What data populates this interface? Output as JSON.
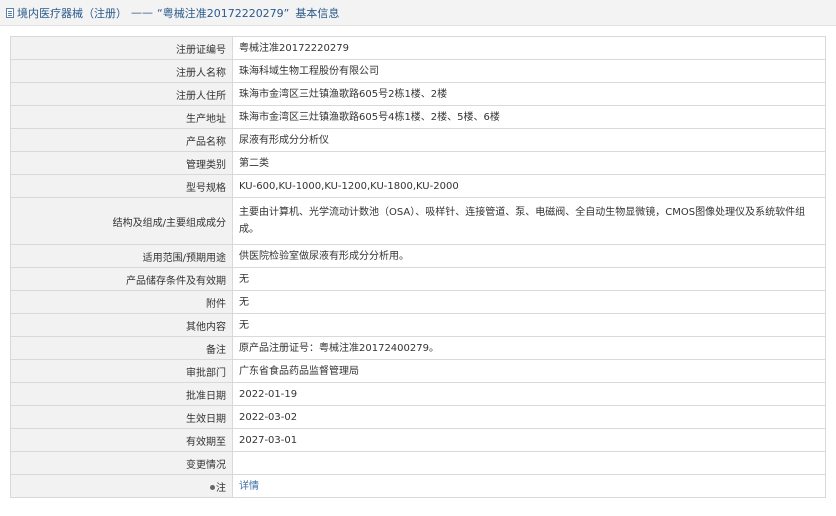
{
  "breadcrumb": {
    "category": "境内医疗器械（注册）",
    "separator": "——",
    "record": "“粤械注准20172220279”",
    "section": "基本信息"
  },
  "rows": [
    {
      "label": "注册证编号",
      "value": "粤械注准20172220279"
    },
    {
      "label": "注册人名称",
      "value": "珠海科域生物工程股份有限公司"
    },
    {
      "label": "注册人住所",
      "value": "珠海市金湾区三灶镇渔歌路605号2栋1楼、2楼"
    },
    {
      "label": "生产地址",
      "value": "珠海市金湾区三灶镇渔歌路605号4栋1楼、2楼、5楼、6楼"
    },
    {
      "label": "产品名称",
      "value": "尿液有形成分分析仪"
    },
    {
      "label": "管理类别",
      "value": "第二类"
    },
    {
      "label": "型号规格",
      "value": "KU-600,KU-1000,KU-1200,KU-1800,KU-2000"
    },
    {
      "label": "结构及组成/主要组成成分",
      "value": "主要由计算机、光学流动计数池（OSA）、吸样针、连接管道、泵、电磁阀、全自动生物显微镜，CMOS图像处理仪及系统软件组成。"
    },
    {
      "label": "适用范围/预期用途",
      "value": "供医院检验室做尿液有形成分分析用。"
    },
    {
      "label": "产品储存条件及有效期",
      "value": "无"
    },
    {
      "label": "附件",
      "value": "无"
    },
    {
      "label": "其他内容",
      "value": "无"
    },
    {
      "label": "备注",
      "value": "原产品注册证号：粤械注准20172400279。"
    },
    {
      "label": "审批部门",
      "value": "广东省食品药品监督管理局"
    },
    {
      "label": "批准日期",
      "value": "2022-01-19"
    },
    {
      "label": "生效日期",
      "value": "2022-03-02"
    },
    {
      "label": "有效期至",
      "value": "2027-03-01"
    },
    {
      "label": "变更情况",
      "value": ""
    },
    {
      "label": "注",
      "value": "详情"
    }
  ],
  "icons": {
    "header": "document-icon",
    "note": "pin-icon"
  },
  "colors": {
    "link": "#3a6ea5",
    "header_text": "#2b5a8b",
    "label_bg": "#f2f2f2"
  }
}
